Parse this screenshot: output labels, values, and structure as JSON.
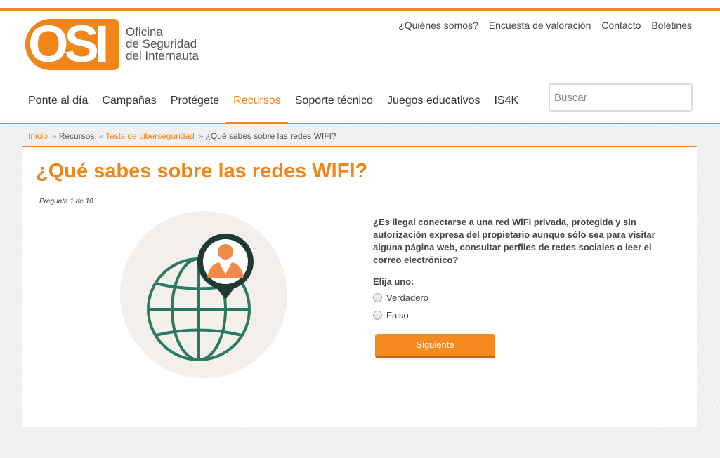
{
  "logo": {
    "letters": "OSI",
    "line1": "Oficina",
    "line2": "de Seguridad",
    "line3": "del Internauta"
  },
  "top_links": [
    "¿Quiénes somos?",
    "Encuesta de valoración",
    "Contacto",
    "Boletines"
  ],
  "main_nav": [
    "Ponte al día",
    "Campañas",
    "Protégete",
    "Recursos",
    "Soporte técnico",
    "Juegos educativos",
    "IS4K"
  ],
  "main_nav_active": "Recursos",
  "search": {
    "placeholder": "Buscar",
    "value": ""
  },
  "breadcrumb": {
    "items": [
      "Inicio",
      "Recursos",
      "Tests de ciberseguridad",
      "¿Qué sabes sobre las redes WIFI?"
    ],
    "separator": "»"
  },
  "page": {
    "title": "¿Qué sabes sobre las redes WIFI?",
    "question_counter": "Pregunta 1 de 10"
  },
  "quiz": {
    "question": "¿Es ilegal conectarse a una red WiFi privada, protegida y sin autorización expresa del propietario aunque sólo sea para visitar alguna página web, consultar perfiles de redes sociales o leer el correo electrónico?",
    "choose_label": "Elija uno:",
    "options": [
      "Verdadero",
      "Falso"
    ],
    "next_label": "Siguiente"
  },
  "illustration": {
    "icons": [
      "globe-icon",
      "map-pin-icon",
      "person-icon"
    ]
  },
  "colors": {
    "accent": "#f08519",
    "globe": "#2a7a62",
    "pin": "#1f3a33",
    "circle_bg": "#f3efec"
  }
}
